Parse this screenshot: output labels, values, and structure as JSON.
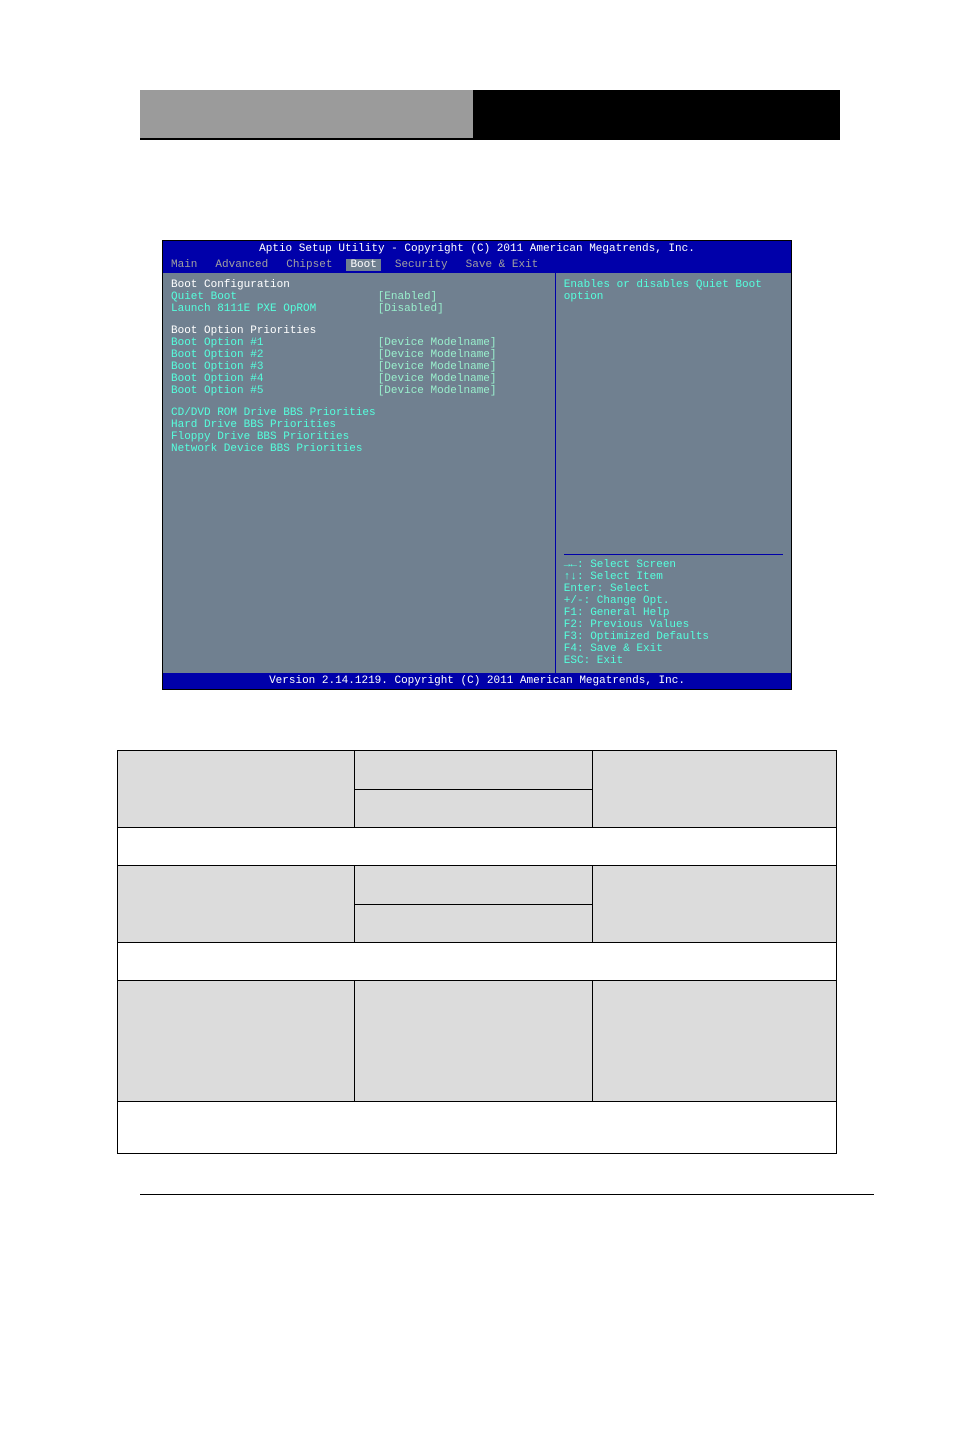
{
  "bios": {
    "title": "Aptio Setup Utility - Copyright (C) 2011 American Megatrends, Inc.",
    "tabs": [
      "Main",
      "Advanced",
      "Chipset",
      "Boot",
      "Security",
      "Save & Exit"
    ],
    "active_tab": "Boot",
    "section1_header": "Boot Configuration",
    "rows1": [
      {
        "label": "Quiet Boot",
        "value": "[Enabled]"
      },
      {
        "label": "Launch 8111E PXE OpROM",
        "value": "[Disabled]"
      }
    ],
    "section2_header": "Boot Option Priorities",
    "rows2": [
      {
        "label": "Boot Option #1",
        "value": "[Device Modelname]"
      },
      {
        "label": "Boot Option #2",
        "value": "[Device Modelname]"
      },
      {
        "label": "Boot Option #3",
        "value": "[Device Modelname]"
      },
      {
        "label": "Boot Option #4",
        "value": "[Device Modelname]"
      },
      {
        "label": "Boot Option #5",
        "value": "[Device Modelname]"
      }
    ],
    "submenus": [
      "CD/DVD ROM Drive BBS Priorities",
      "Hard Drive BBS Priorities",
      "Floppy Drive BBS Priorities",
      "Network Device BBS Priorities"
    ],
    "help_text": "Enables or disables Quiet Boot option",
    "keys": [
      "→←: Select Screen",
      "↑↓: Select Item",
      "Enter: Select",
      "+/-: Change Opt.",
      "F1: General Help",
      "F2: Previous Values",
      "F3: Optimized Defaults",
      "F4: Save & Exit",
      "ESC: Exit"
    ],
    "footer": "Version 2.14.1219. Copyright (C) 2011 American Megatrends, Inc."
  }
}
